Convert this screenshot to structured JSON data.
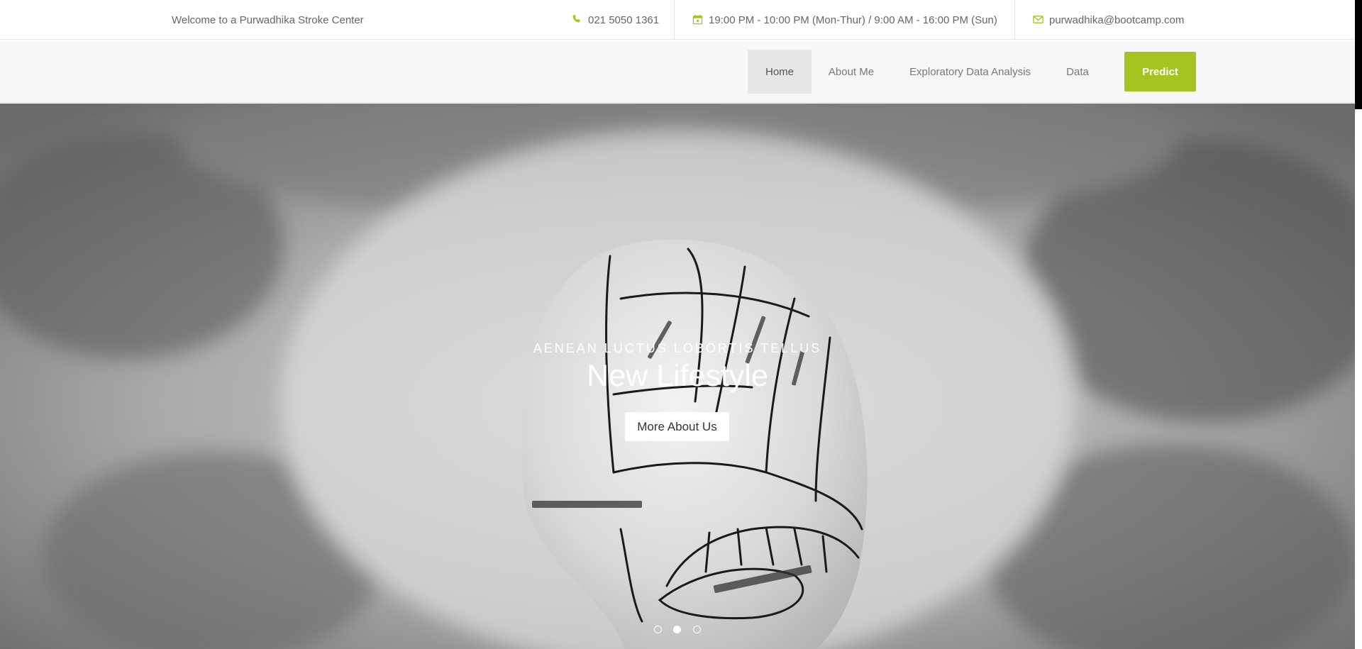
{
  "topbar": {
    "welcome": "Welcome to a Purwadhika Stroke Center",
    "phone": "021 5050 1361",
    "hours": "19:00 PM - 10:00 PM (Mon-Thur) / 9:00 AM - 16:00 PM (Sun)",
    "email": "purwadhika@bootcamp.com",
    "icon_names": [
      "phone-icon",
      "calendar-icon",
      "envelope-icon"
    ]
  },
  "nav": {
    "items": [
      {
        "label": "Home",
        "active": true
      },
      {
        "label": "About Me",
        "active": false
      },
      {
        "label": "Exploratory Data Analysis",
        "active": false
      },
      {
        "label": "Data",
        "active": false
      }
    ],
    "predict_label": "Predict"
  },
  "hero": {
    "kicker": "Aenean luctus lobortis tellus",
    "title": "New Lifestyle",
    "button_label": "More About Us",
    "slide_count": 3,
    "active_slide": 2
  },
  "colors": {
    "accent": "#a5c420",
    "text_muted": "#666666",
    "nav_bg": "#f7f7f7"
  }
}
